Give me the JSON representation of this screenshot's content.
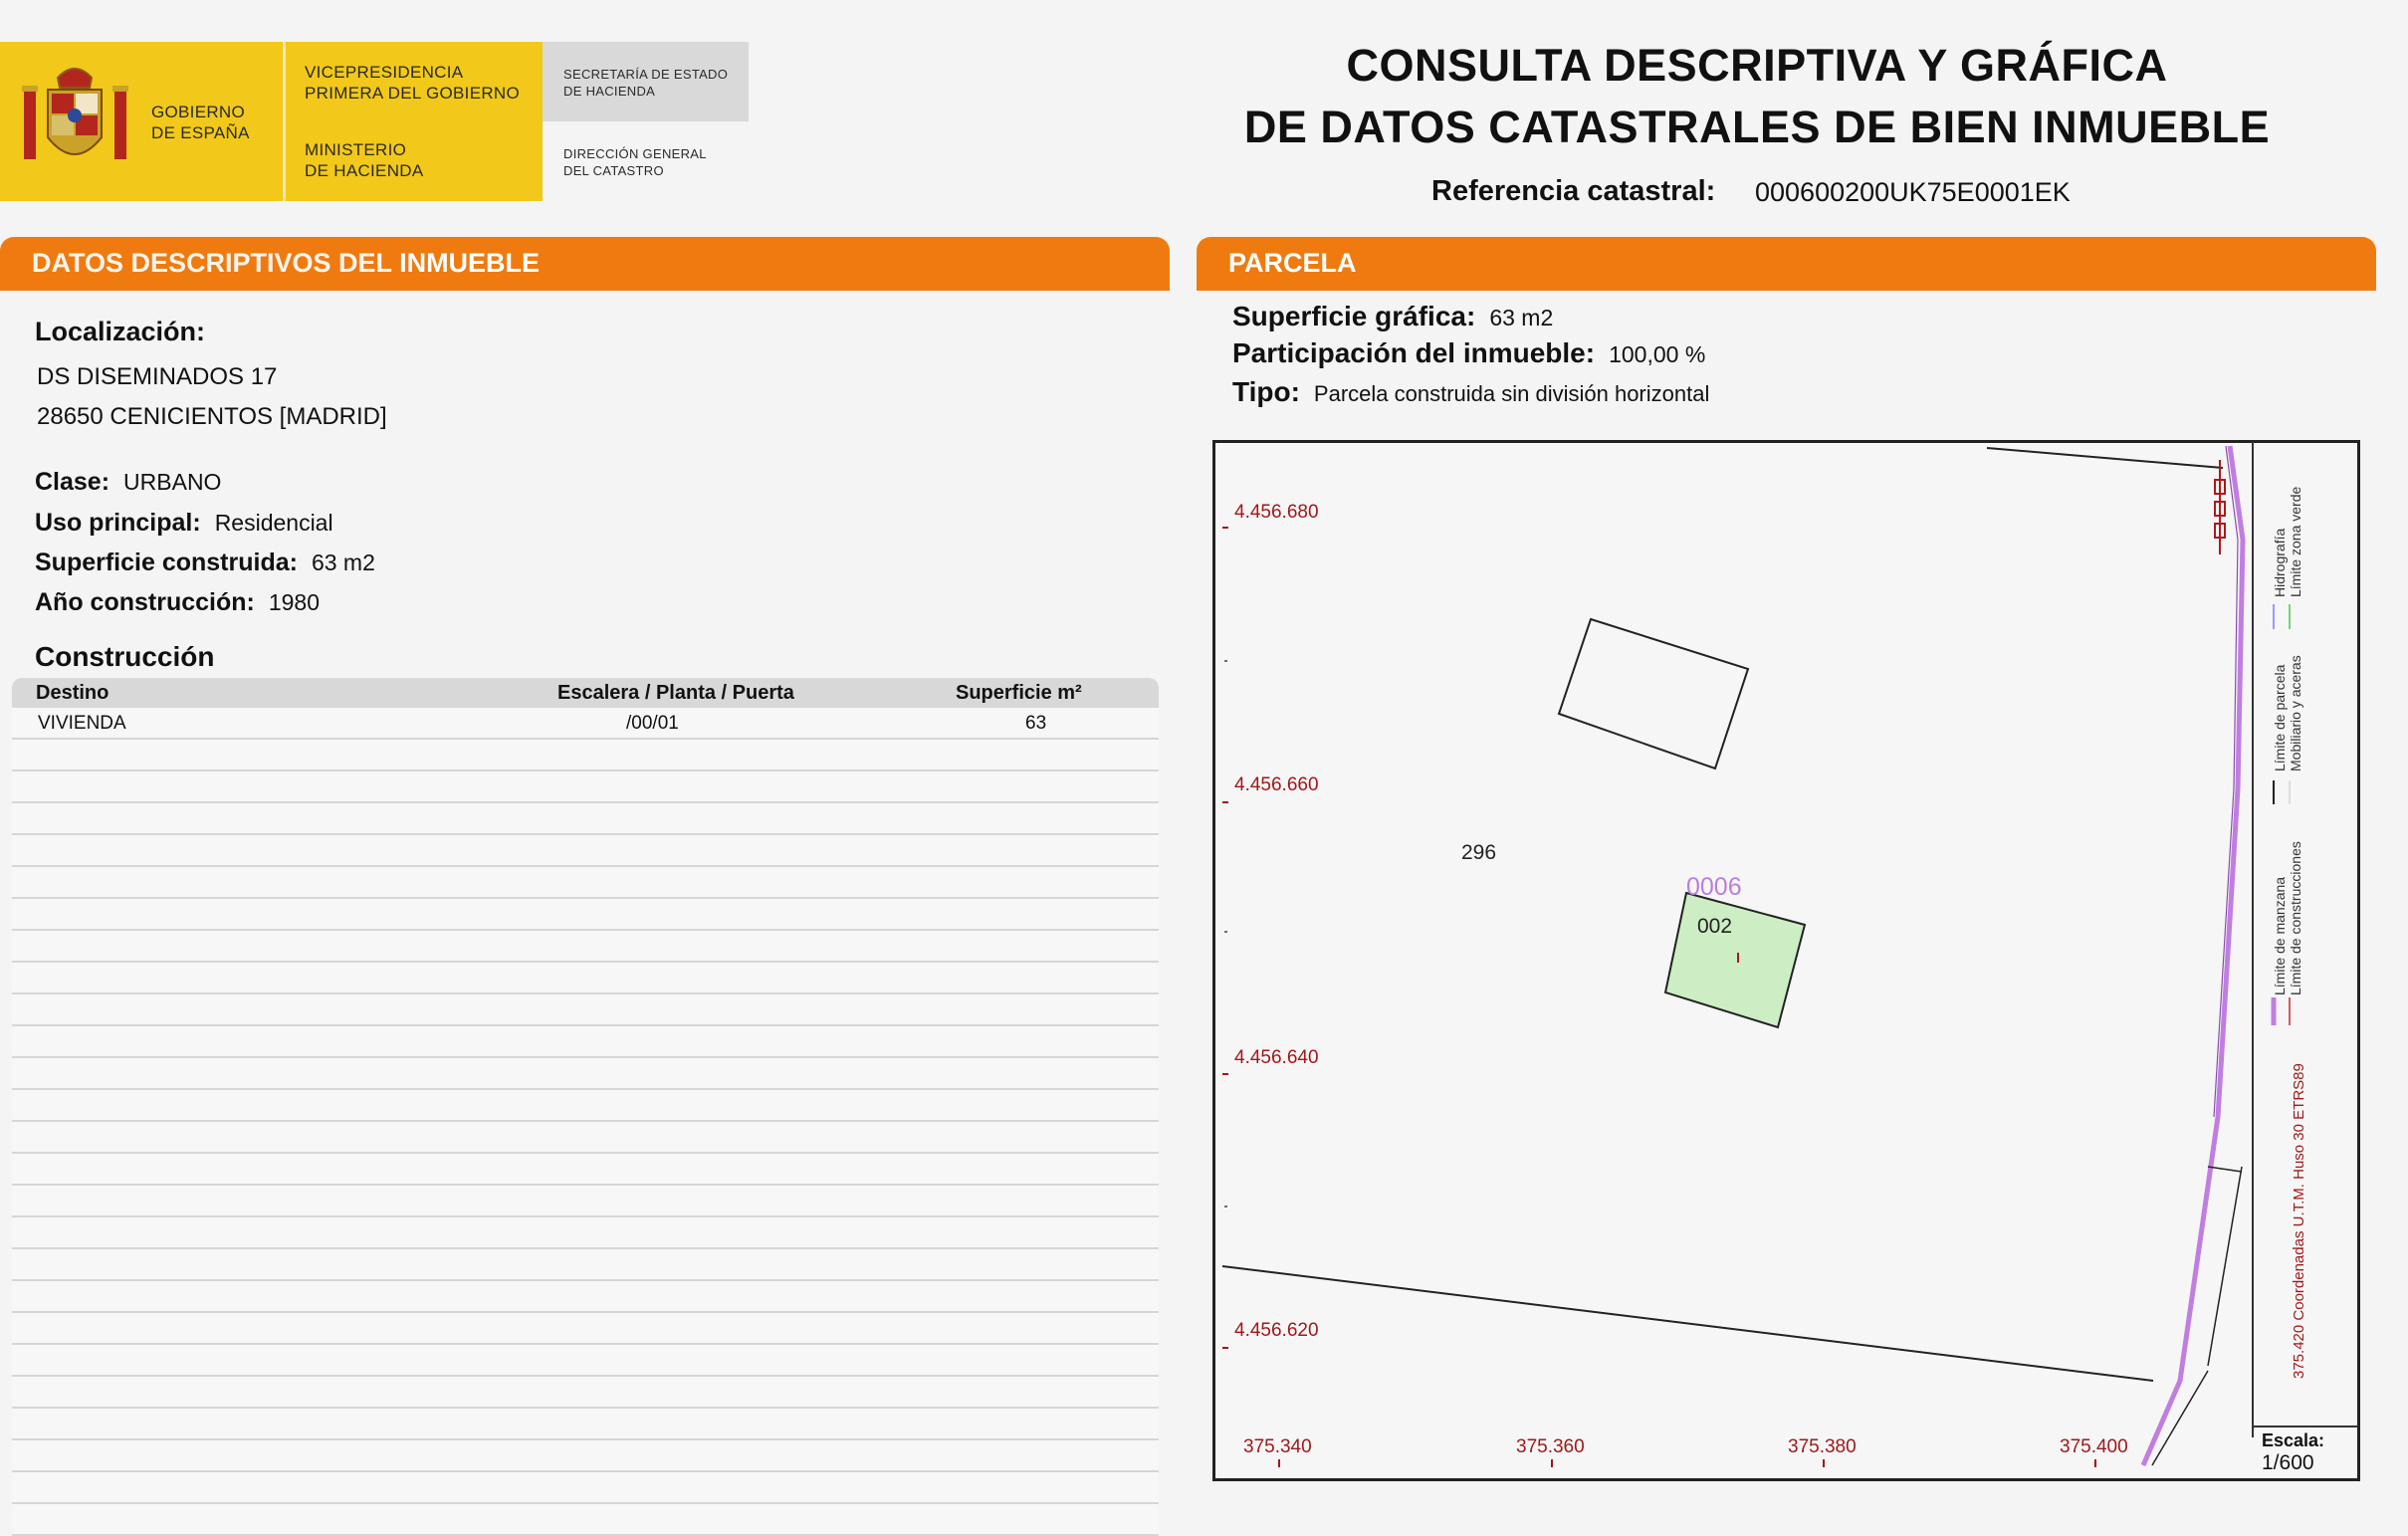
{
  "header": {
    "gobierno_line1": "GOBIERNO",
    "gobierno_line2": "DE ESPAÑA",
    "vicepresidencia_line1": "VICEPRESIDENCIA",
    "vicepresidencia_line2": "PRIMERA DEL GOBIERNO",
    "ministerio_line1": "MINISTERIO",
    "ministerio_line2": "DE HACIENDA",
    "secretaria_line1": "SECRETARÍA DE ESTADO",
    "secretaria_line2": "DE HACIENDA",
    "direccion_line1": "DIRECCIÓN GENERAL",
    "direccion_line2": "DEL CATASTRO",
    "title_line1": "CONSULTA DESCRIPTIVA Y GRÁFICA",
    "title_line2": "DE DATOS CATASTRALES DE BIEN INMUEBLE",
    "refcat_label": "Referencia catastral:",
    "refcat_value": "000600200UK75E0001EK"
  },
  "descriptivos": {
    "section_title_a": "DATOS DESCRIPTIVOS DEL ",
    "section_title_b": "INMUEBLE",
    "localizacion_label": "Localización:",
    "address_line1": "DS DISEMINADOS 17",
    "address_line2": "28650 CENICIENTOS [MADRID]",
    "clase_label": "Clase:",
    "clase_value": "URBANO",
    "uso_label": "Uso principal:",
    "uso_value": "Residencial",
    "superficie_label": "Superficie construida:",
    "superficie_value": "63 m2",
    "anio_label": "Año construcción:",
    "anio_value": "1980",
    "construccion_label": "Construcción",
    "table": {
      "headers": [
        "Destino",
        "Escalera / Planta / Puerta",
        "Superficie m²"
      ],
      "rows": [
        [
          "VIVIENDA",
          "/00/01",
          "63"
        ]
      ]
    }
  },
  "parcela": {
    "section_title": "PARCELA",
    "superficie_label": "Superficie gráfica:",
    "superficie_value": "63 m2",
    "participacion_label": "Participación del inmueble:",
    "participacion_value": "100,00 %",
    "tipo_label": "Tipo:",
    "tipo_value": "Parcela construida sin división horizontal"
  },
  "map": {
    "y_labels": [
      "4.456.680",
      "4.456.660",
      "4.456.640",
      "4.456.620"
    ],
    "x_labels": [
      "375.340",
      "375.360",
      "375.380",
      "375.400"
    ],
    "label_296": "296",
    "label_0006": "0006",
    "label_002": "002",
    "scale_label": "Escala:",
    "scale_value": "1/600",
    "coords_note": "375.420 Coordenadas U.T.M. Huso 30 ETRS89",
    "legend": [
      "Límite de manzana",
      "Límite de construcciones",
      "Límite de parcela",
      "Mobiliario y aceras",
      "Hidrografía",
      "Límite zona verde"
    ],
    "colors": {
      "hidrografia": "#c07ee0",
      "construccion_fill": "#cdeec4",
      "red_labels": "#a01818",
      "section_orange": "#ef7b10",
      "gov_yellow": "#f2c81a"
    }
  }
}
